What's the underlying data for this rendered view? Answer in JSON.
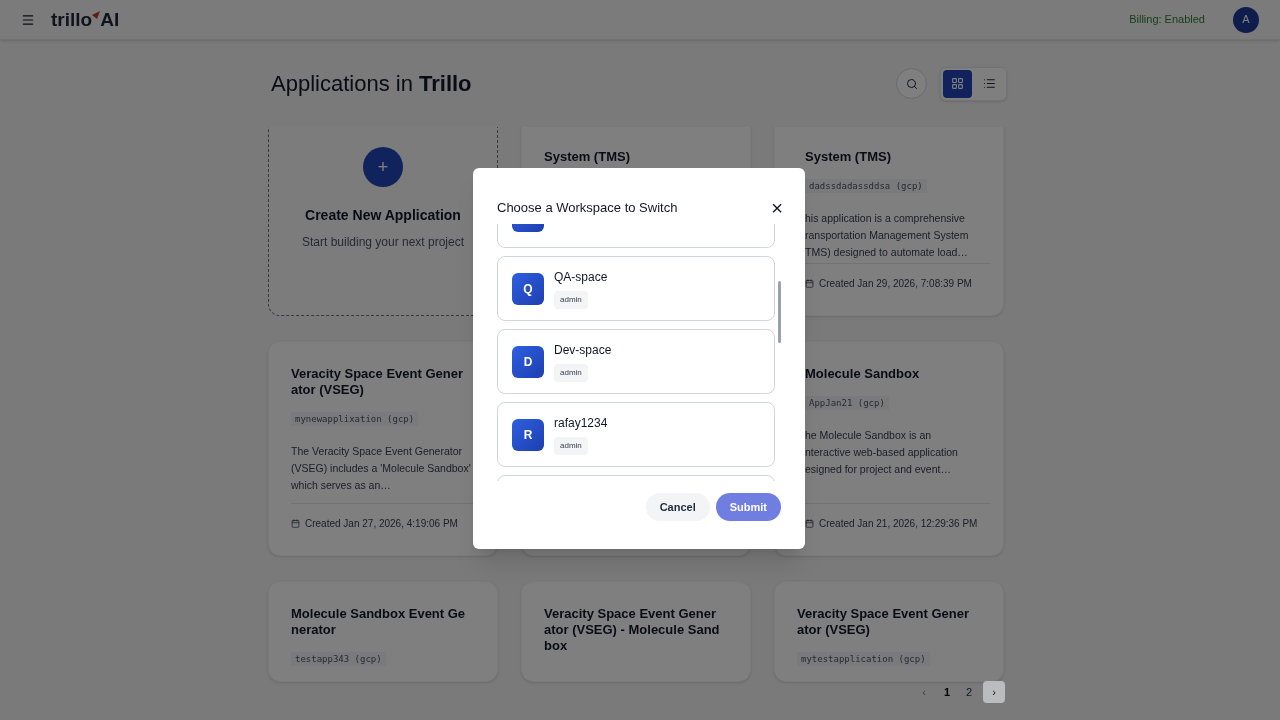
{
  "header": {
    "logo_left": "trillo",
    "logo_right": "AI",
    "billing": "Billing: Enabled",
    "avatar": "A"
  },
  "page": {
    "title_prefix": "Applications in ",
    "title_bold": "Trillo"
  },
  "view_toggle": [
    {
      "kind": "grid",
      "selected": true
    },
    {
      "kind": "list",
      "selected": false
    }
  ],
  "create_card": {
    "icon": "+",
    "title": "Create New Application",
    "subtitle": "Start building your next project"
  },
  "cards": [
    {
      "title": "System (TMS)"
    },
    {
      "title": "System (TMS)",
      "code": "dadssdadassddsa (gcp)",
      "description": "his application is a comprehensive ransportation Management System TMS) designed to automate load…",
      "created": "Created Jan 29, 2026, 7:08:39 PM"
    },
    {
      "title": "Veracity Space Event Gener ator (VSEG)",
      "code": "mynewapplixation (gcp)",
      "description": "The Veracity Space Event Generator (VSEG) includes a 'Molecule Sandbox' which serves as an…",
      "created": "Created Jan 27, 2026, 4:19:06 PM"
    },
    {
      "title": "Molecule Sandbox",
      "code": "AppJan21 (gcp)",
      "description": "he Molecule Sandbox is an nteractive web-based application esigned for project and event…",
      "created": "Created Jan 21, 2026, 12:29:36 PM"
    },
    {
      "title": "Molecule Sandbox Event Ge nerator",
      "code": "testapp343 (gcp)"
    },
    {
      "title": "Veracity Space Event Gener ator (VSEG) - Molecule Sand box"
    },
    {
      "title": "Veracity Space Event Gener ator (VSEG)",
      "code": "mytestapplication (gcp)"
    }
  ],
  "pagination": {
    "prev": "‹",
    "next": "›",
    "pages": [
      {
        "label": "1",
        "selected": true
      },
      {
        "label": "2",
        "selected": false
      }
    ]
  },
  "dialog": {
    "title": "Choose a Workspace to Switch",
    "close": "×",
    "workspaces": [
      {
        "initial": "Q",
        "name": "QA-space",
        "role": "admin"
      },
      {
        "initial": "D",
        "name": "Dev-space",
        "role": "admin"
      },
      {
        "initial": "R",
        "name": "rafay1234",
        "role": "admin"
      }
    ],
    "buttons": [
      {
        "kind": "cancel",
        "label": "Cancel"
      },
      {
        "kind": "submit",
        "label": "Submit"
      }
    ]
  }
}
